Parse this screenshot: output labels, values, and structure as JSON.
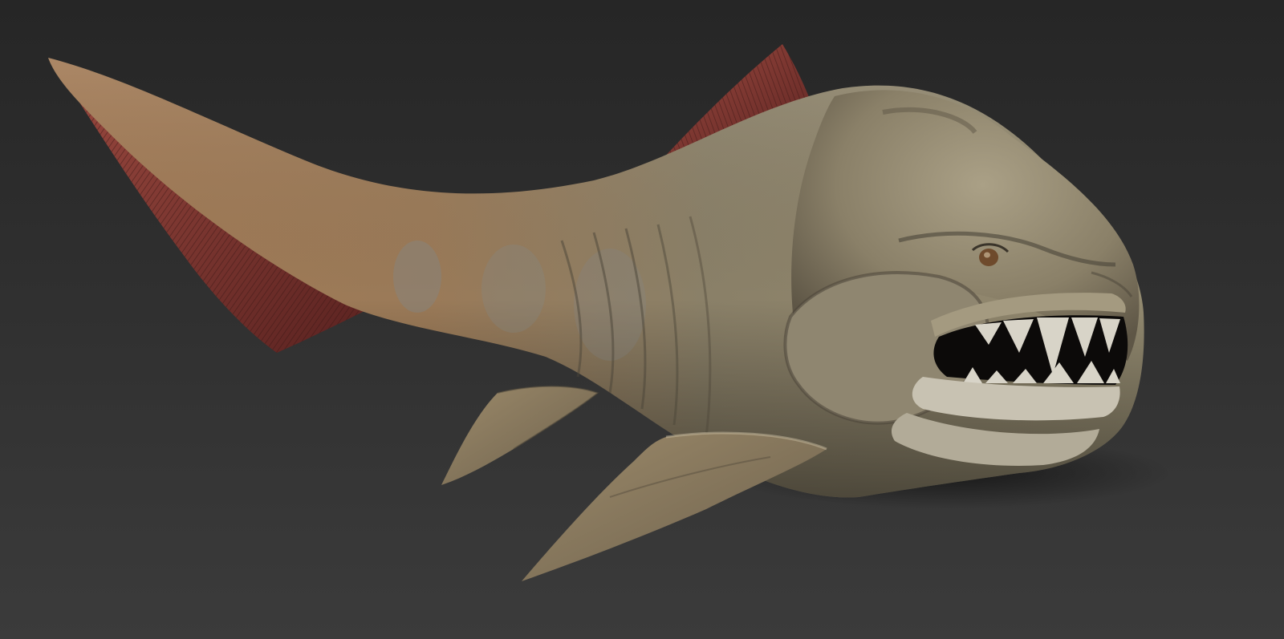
{
  "scene": {
    "subject": "sculpted-prehistoric-armored-fish",
    "colors": {
      "background_top": "#262626",
      "background_bottom": "#3b3b3b",
      "skin_main": "#8a8068",
      "skin_light": "#aaa086",
      "skin_dark": "#4a4438",
      "tail_rust": "#a27a55",
      "fin_red": "#8e3a36",
      "fin_red_dark": "#5a2220",
      "teeth": "#d8d4c8",
      "mouth_inside": "#0c0a09",
      "eye": "#6e4a2c"
    }
  }
}
